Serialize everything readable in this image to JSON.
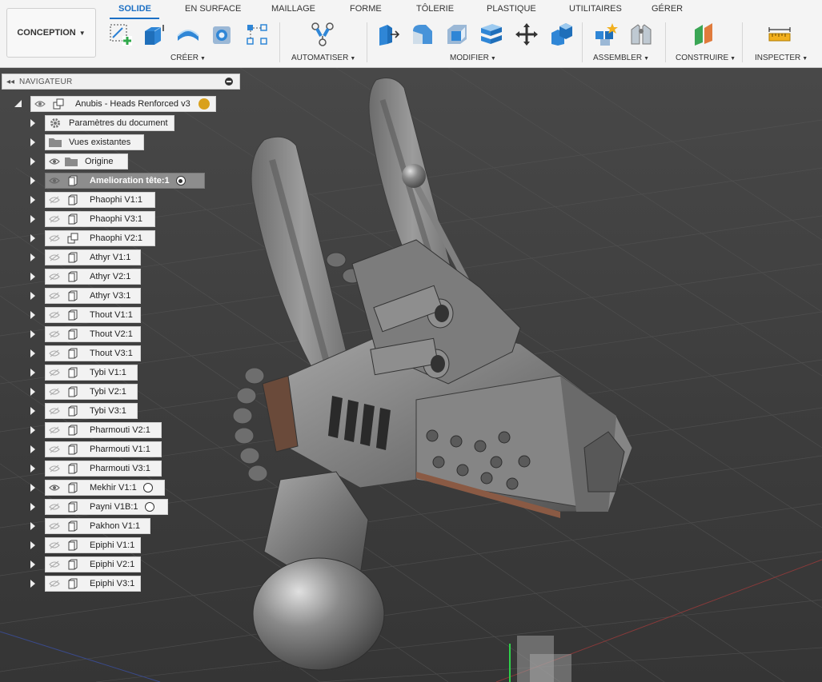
{
  "toolbar": {
    "workspace": "CONCEPTION",
    "tabs": [
      "SOLIDE",
      "EN SURFACE",
      "MAILLAGE",
      "FORME",
      "TÔLERIE",
      "PLASTIQUE",
      "UTILITAIRES",
      "GÉRER"
    ],
    "groups": {
      "creer": "CRÉER",
      "automatiser": "AUTOMATISER",
      "modifier": "MODIFIER",
      "assembler": "ASSEMBLER",
      "construire": "CONSTRUIRE",
      "inspecter": "INSPECTER"
    },
    "accent": "#1b6fc4"
  },
  "navigator": {
    "title": "NAVIGATEUR",
    "root": "Anubis - Heads Renforced v3",
    "folders": [
      "Paramètres du document",
      "Vues existantes",
      "Origine"
    ],
    "components": [
      "Amelioration tête:1",
      "Phaophi  V1:1",
      "Phaophi  V3:1",
      "Phaophi  V2:1",
      "Athyr  V1:1",
      "Athyr  V2:1",
      "Athyr  V3:1",
      "Thout  V1:1",
      "Thout  V2:1",
      "Thout  V3:1",
      "Tybi  V1:1",
      "Tybi  V2:1",
      "Tybi  V3:1",
      "Pharmouti  V2:1",
      "Pharmouti   V1:1",
      "Pharmouti   V3:1",
      "Mekhir V1:1",
      "Payni  V1B:1",
      "Pakhon  V1:1",
      "Epiphi V1:1",
      "Epiphi V2:1",
      "Epiphi V3:1"
    ]
  }
}
